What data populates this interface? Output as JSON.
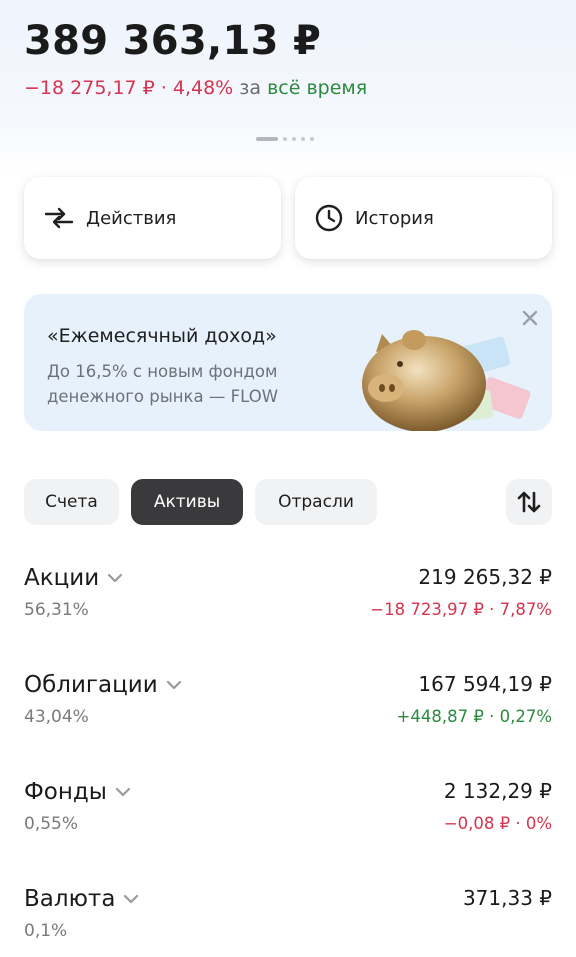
{
  "portfolio": {
    "total": "389 363,13 ₽",
    "change_value": "−18 275,17 ₽ · 4,48%",
    "change_prefix": "за",
    "change_period": "всё время"
  },
  "actions": {
    "actions_label": "Действия",
    "history_label": "История"
  },
  "promo": {
    "title": "«Ежемесячный доход»",
    "text": "До 16,5% с новым фондом денежного рынка — FLOW"
  },
  "tabs": [
    {
      "label": "Счета",
      "active": false
    },
    {
      "label": "Активы",
      "active": true
    },
    {
      "label": "Отрасли",
      "active": false
    }
  ],
  "assets": [
    {
      "name": "Акции",
      "share": "56,31%",
      "amount": "219 265,32 ₽",
      "change": "−18 723,97 ₽ · 7,87%",
      "trend": "negative"
    },
    {
      "name": "Облигации",
      "share": "43,04%",
      "amount": "167 594,19 ₽",
      "change": "+448,87 ₽ · 0,27%",
      "trend": "positive"
    },
    {
      "name": "Фонды",
      "share": "0,55%",
      "amount": "2 132,29 ₽",
      "change": "−0,08 ₽ · 0%",
      "trend": "negative"
    },
    {
      "name": "Валюта",
      "share": "0,1%",
      "amount": "371,33 ₽",
      "change": "",
      "trend": "none"
    }
  ],
  "colors": {
    "negative": "#d6344f",
    "positive": "#2b8a3e",
    "active_tab": "#3a3a3c"
  },
  "icons": {
    "actions": "swap-arrows-icon",
    "history": "clock-icon",
    "close": "close-icon",
    "sort": "sort-arrows-icon",
    "expand": "chevron-down-icon"
  }
}
